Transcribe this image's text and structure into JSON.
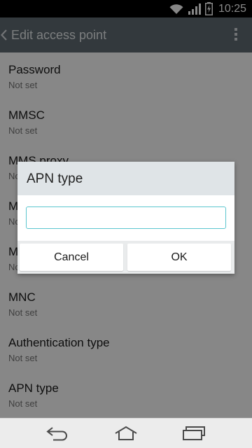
{
  "status_bar": {
    "time": "10:25",
    "icons": [
      "wifi-icon",
      "signal-icon",
      "battery-charging-icon"
    ]
  },
  "action_bar": {
    "title": "Edit access point",
    "back_icon": "chevron-left-icon",
    "menu_icon": "overflow-menu-icon"
  },
  "settings": {
    "items": [
      {
        "title": "Password",
        "summary": "Not set"
      },
      {
        "title": "MMSC",
        "summary": "Not set"
      },
      {
        "title": "MMS proxy",
        "summary": "Not set"
      },
      {
        "title": "MMS port",
        "summary": "Not set"
      },
      {
        "title": "MCC",
        "summary": "Not set"
      },
      {
        "title": "MNC",
        "summary": "Not set"
      },
      {
        "title": "Authentication type",
        "summary": "Not set"
      },
      {
        "title": "APN type",
        "summary": "Not set"
      }
    ]
  },
  "dialog": {
    "title": "APN type",
    "input_value": "",
    "cancel_label": "Cancel",
    "ok_label": "OK"
  },
  "nav_bar": {
    "icons": [
      "back-icon",
      "home-icon",
      "recent-apps-icon"
    ]
  }
}
